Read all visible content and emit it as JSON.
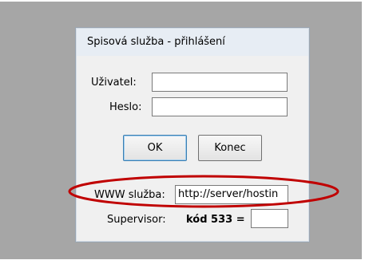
{
  "dialog": {
    "title": "Spisová služba - přihlášení",
    "user_label": "Uživatel:",
    "user_value": "",
    "password_label": "Heslo:",
    "password_value": "",
    "ok_label": "OK",
    "exit_label": "Konec",
    "www_label": "WWW služba:",
    "www_value": "http://server/hostin",
    "supervisor_label": "Supervisor:",
    "supervisor_code": "kód 533 =",
    "supervisor_value": ""
  },
  "annotation": {
    "color": "#c00000"
  }
}
